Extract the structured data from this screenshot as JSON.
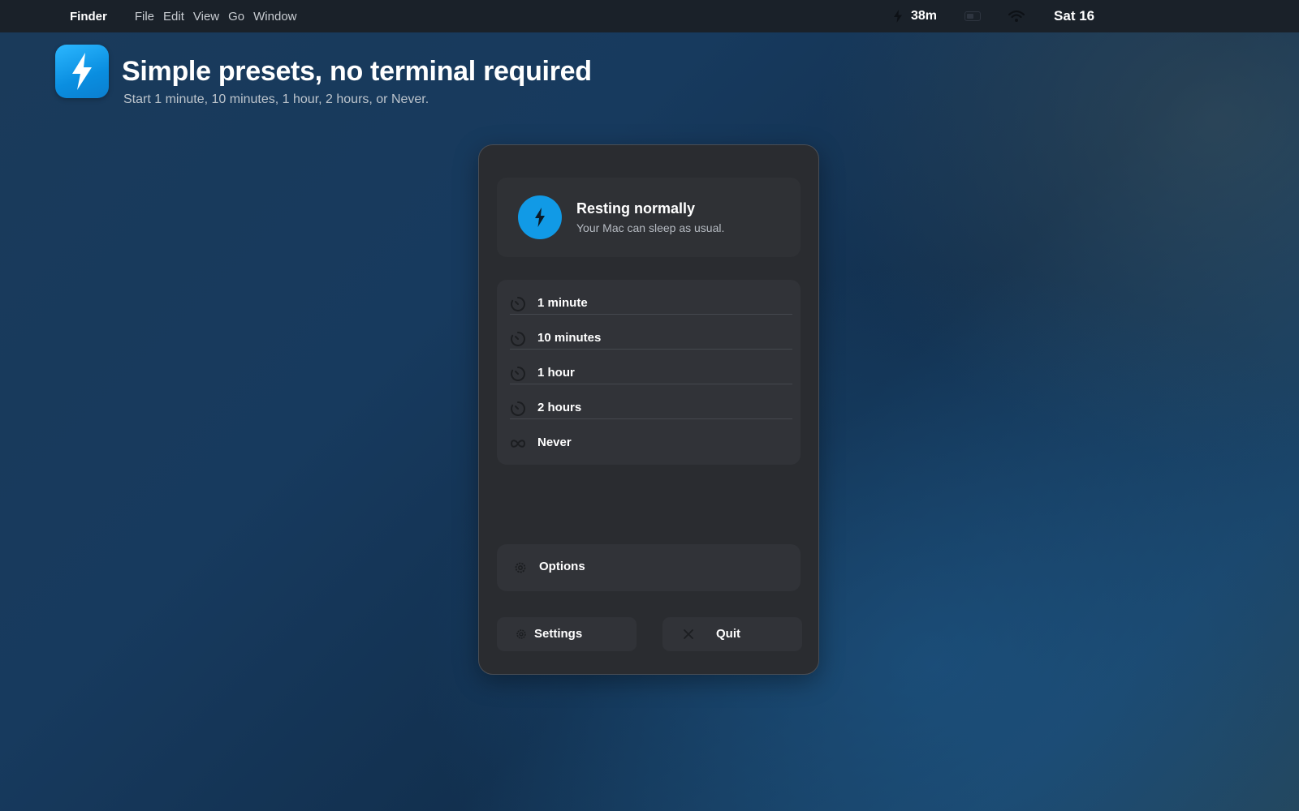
{
  "menubar": {
    "app_name": "Finder",
    "items": [
      "File",
      "Edit",
      "View",
      "Go",
      "Window"
    ],
    "timer": "38m",
    "date": "Sat 16",
    "icons": [
      "bolt-icon",
      "battery-icon",
      "wifi-icon"
    ]
  },
  "hero": {
    "title": "Simple presets, no terminal required",
    "subtitle": "Start 1 minute, 10 minutes, 1 hour, 2 hours, or Never.",
    "icon": "bolt-icon",
    "accent": "#119ae6"
  },
  "panel": {
    "status": {
      "title": "Resting normally",
      "subtitle": "Your Mac can sleep as usual.",
      "icon": "bolt-icon"
    },
    "presets": [
      {
        "label": "1 minute",
        "icon": "timer-icon"
      },
      {
        "label": "10 minutes",
        "icon": "timer-icon"
      },
      {
        "label": "1 hour",
        "icon": "timer-icon"
      },
      {
        "label": "2 hours",
        "icon": "timer-icon"
      },
      {
        "label": "Never",
        "icon": "infinity-icon"
      }
    ],
    "options_label": "Options",
    "settings_label": "Settings",
    "quit_label": "Quit"
  }
}
